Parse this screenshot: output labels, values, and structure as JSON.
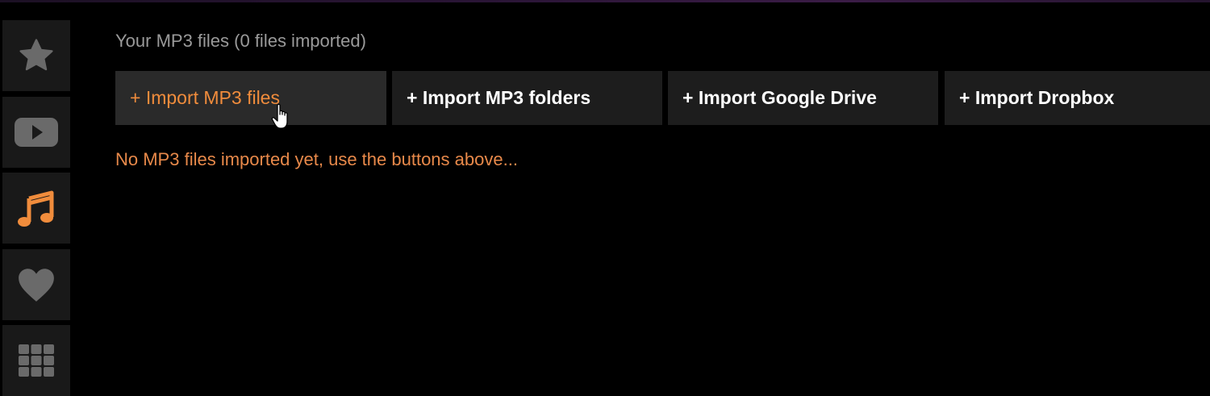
{
  "sidebar": {
    "items": [
      {
        "icon": "star-icon",
        "active": false
      },
      {
        "icon": "youtube-icon",
        "active": false
      },
      {
        "icon": "music-note-icon",
        "active": true
      },
      {
        "icon": "heart-icon",
        "active": false
      },
      {
        "icon": "grid-icon",
        "active": false
      }
    ],
    "colors": {
      "inactive": "#6a6a6a",
      "active": "#f08c3c"
    }
  },
  "main": {
    "heading": "Your MP3 files (0 files imported)",
    "buttons": [
      {
        "label": "+ Import MP3 files",
        "active": true
      },
      {
        "label": "+ Import MP3 folders",
        "active": false
      },
      {
        "label": "+ Import Google Drive",
        "active": false
      },
      {
        "label": "+ Import Dropbox",
        "active": false
      }
    ],
    "empty_message": "No MP3 files imported yet, use the buttons above..."
  },
  "accent_color": "#f08c3c"
}
